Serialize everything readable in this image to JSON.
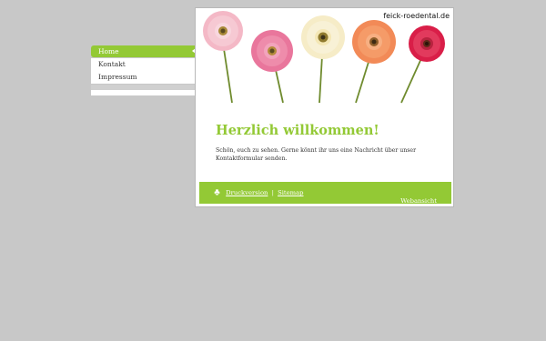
{
  "nav": {
    "items": [
      {
        "label": "Home",
        "active": true
      },
      {
        "label": "Kontakt",
        "active": false
      },
      {
        "label": "Impressum",
        "active": false
      }
    ]
  },
  "header": {
    "domain": "feick-roedental.de"
  },
  "main": {
    "title": "Herzlich willkommen!",
    "intro": "Schön, euch zu sehen. Gerne könnt ihr uns eine Nachricht über unser Kontaktformular senden."
  },
  "footer": {
    "print_label": "Druckversion",
    "separator": "|",
    "sitemap_label": "Sitemap",
    "web_view_label": "Webansicht"
  },
  "colors": {
    "accent": "#93c935",
    "background": "#c8c8c8"
  }
}
